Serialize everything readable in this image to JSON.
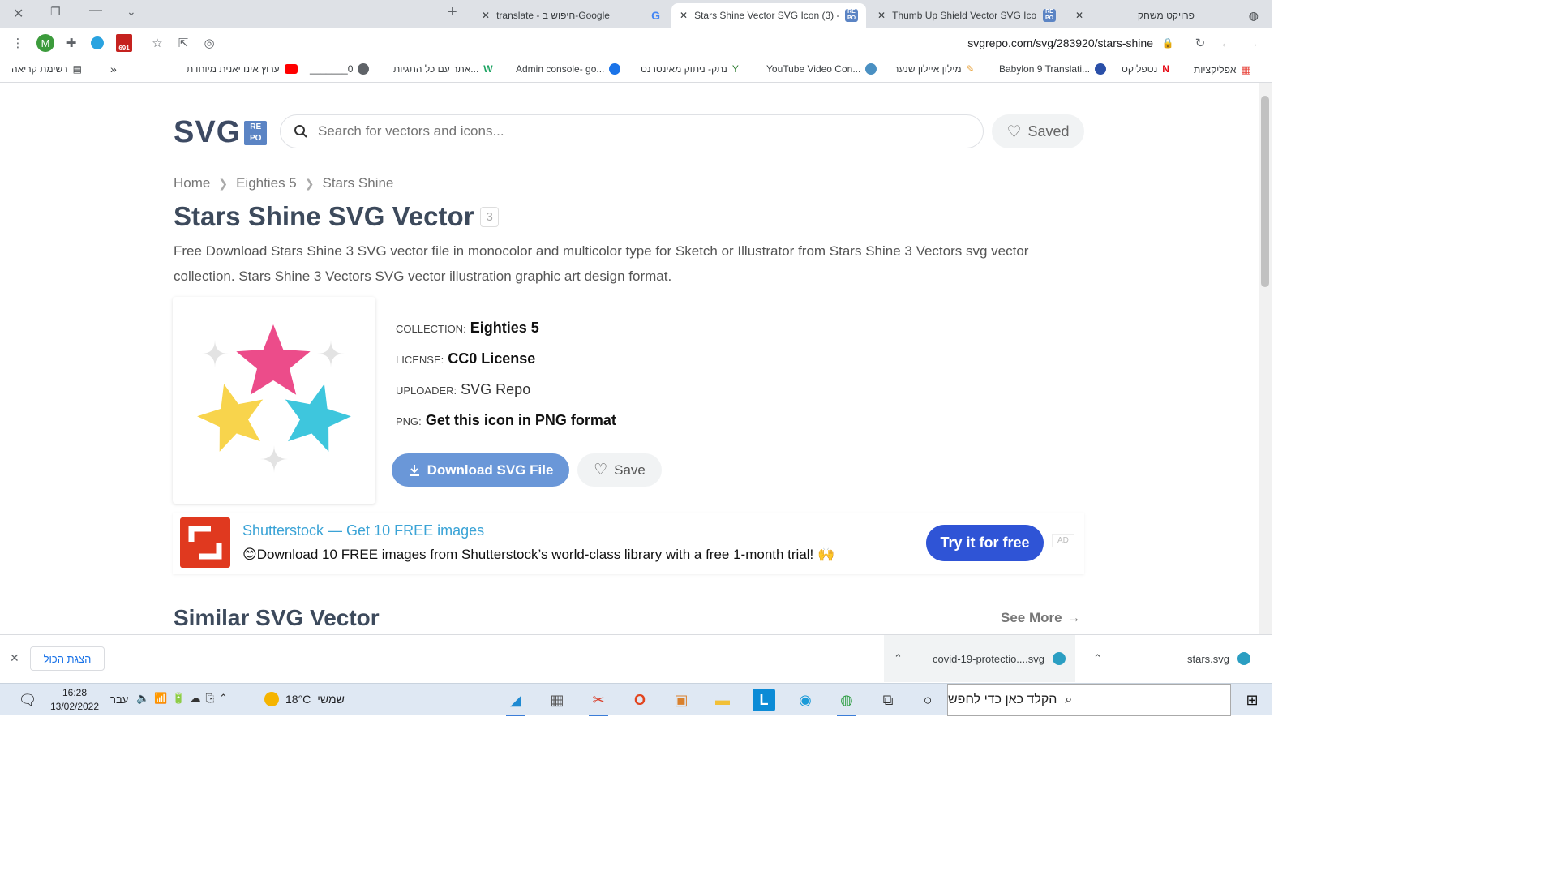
{
  "browser": {
    "tabs": [
      {
        "title": "translate - חיפוש ב-Google",
        "active": false
      },
      {
        "title": "Stars Shine Vector SVG Icon (3) -",
        "active": true
      },
      {
        "title": "Thumb Up Shield Vector SVG Ico",
        "active": false
      },
      {
        "title": "פרויקט משחק",
        "active": false
      }
    ],
    "profile_initial": "M",
    "gmail_badge": "691",
    "url": "svgrepo.com/svg/283920/stars-shine",
    "bookmarks": {
      "reading_list": "רשימת קריאה",
      "overflow": "»",
      "items": [
        "ערוץ אינדיאנית מיוחדת",
        "_______0",
        "אתר עם כל התגיות...",
        "Admin console- go...",
        "נתק- ניתוק מאינטרנט",
        "YouTube Video Con...",
        "מילון איילון שנער",
        "Babylon 9 Translati...",
        "נטפליקס",
        "אפליקציות"
      ]
    }
  },
  "site": {
    "logo_main": "SVG",
    "logo_badge_top": "RE",
    "logo_badge_bottom": "PO",
    "search_placeholder": "Search for vectors and icons...",
    "saved_label": "Saved",
    "breadcrumbs": [
      "Home",
      "Eighties 5",
      "Stars Shine"
    ],
    "title": "Stars Shine SVG Vector",
    "title_badge": "3",
    "description": "Free Download Stars Shine 3 SVG vector file in monocolor and multicolor type for Sketch or Illustrator from Stars Shine 3 Vectors svg vector collection. Stars Shine 3 Vectors SVG vector illustration graphic art design format.",
    "meta": [
      {
        "key": "COLLECTION:",
        "value": "Eighties 5"
      },
      {
        "key": "LICENSE:",
        "value": "CC0 License"
      },
      {
        "key": "UPLOADER:",
        "value": "SVG Repo"
      },
      {
        "key": "PNG:",
        "value": "Get this icon in PNG format"
      }
    ],
    "download_label": "Download SVG File",
    "save_label": "Save",
    "ad": {
      "title": "Shutterstock — Get 10 FREE images",
      "subtitle": "Download 10 FREE images from Shutterstock’s world-class library with a free 1-month trial!",
      "cta": "Try it for free",
      "tag": "AD"
    },
    "similar_heading": "Similar SVG Vector",
    "see_more": "See More",
    "star_colors": {
      "pink": "#ec4c8a",
      "yellow": "#f8d44c",
      "teal": "#3ec6dd",
      "sparkle": "#e3e3e3"
    }
  },
  "downloads": {
    "show_all": "הצגת הכול",
    "files": [
      "covid-19-protectio....svg",
      "stars.svg"
    ]
  },
  "taskbar": {
    "search_placeholder": "הקלד כאן כדי לחפש",
    "weather_temp": "18°C",
    "weather_label": "שמשי",
    "lang": "עבר",
    "time": "16:28",
    "date": "13/02/2022"
  }
}
